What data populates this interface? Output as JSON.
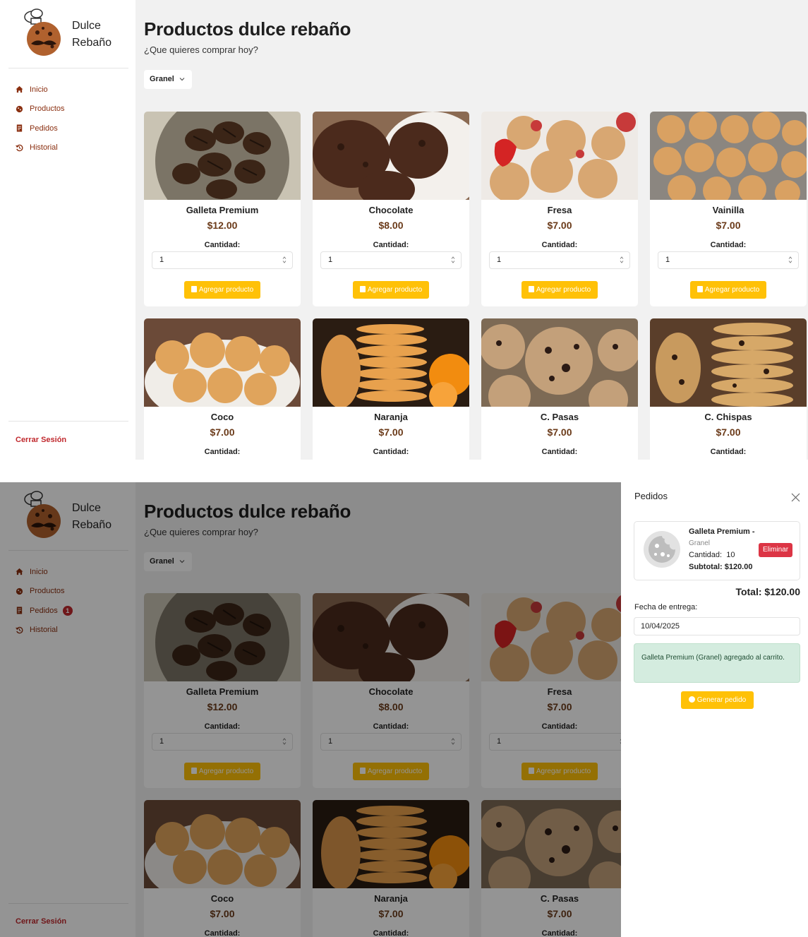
{
  "brand": {
    "line1": "Dulce",
    "line2": "Rebaño"
  },
  "nav": [
    {
      "label": "Inicio",
      "icon": "home-icon"
    },
    {
      "label": "Productos",
      "icon": "cookie-icon"
    },
    {
      "label": "Pedidos",
      "icon": "receipt-icon"
    },
    {
      "label": "Historial",
      "icon": "history-icon"
    }
  ],
  "orders_badge": "1",
  "logout_label": "Cerrar Sesión",
  "page": {
    "title": "Productos dulce rebaño",
    "subtitle": "¿Que quieres comprar hoy?"
  },
  "filter": {
    "selected": "Granel"
  },
  "quantity_label": "Cantidad:",
  "quantity_default": "1",
  "add_label": "Agregar producto",
  "products": [
    {
      "name": "Galleta Premium",
      "price": "$12.00"
    },
    {
      "name": "Chocolate",
      "price": "$8.00"
    },
    {
      "name": "Fresa",
      "price": "$7.00"
    },
    {
      "name": "Vainilla",
      "price": "$7.00"
    },
    {
      "name": "Coco",
      "price": "$7.00"
    },
    {
      "name": "Naranja",
      "price": "$7.00"
    },
    {
      "name": "C. Pasas",
      "price": "$7.00"
    },
    {
      "name": "C. Chispas",
      "price": "$7.00"
    }
  ],
  "cart": {
    "title": "Pedidos",
    "item": {
      "name": "Galleta Premium -",
      "variant": "Granel",
      "qty_label": "Cantidad:",
      "qty": "10",
      "subtotal": "Subtotal: $120.00"
    },
    "remove_label": "Eliminar",
    "total": "Total: $120.00",
    "date_label": "Fecha de entrega:",
    "date_value": "10/04/2025",
    "alert": "Galleta Premium (Granel) agregado al carrito.",
    "submit_label": "Generar pedido"
  },
  "colors": {
    "accent": "#ffc107",
    "brand_text": "#8a2f10",
    "danger": "#dc3545",
    "price": "#6b3b1a"
  }
}
